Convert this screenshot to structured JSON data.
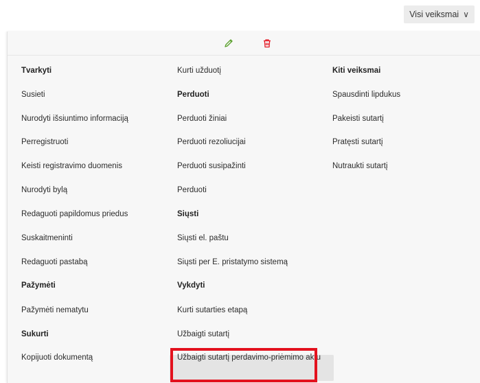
{
  "header": {
    "all_actions_label": "Visi veiksmai",
    "chevron": "∨"
  },
  "toolbar": {
    "edit_icon": "pencil-icon",
    "delete_icon": "trash-icon",
    "edit_color": "#5aa02c",
    "delete_color": "#e3121e"
  },
  "columns": [
    {
      "items": [
        {
          "label": "Tvarkyti",
          "heading": true
        },
        {
          "label": "Susieti",
          "heading": false
        },
        {
          "label": "Nurodyti išsiuntimo informaciją",
          "heading": false
        },
        {
          "label": "Perregistruoti",
          "heading": false
        },
        {
          "label": "Keisti registravimo duomenis",
          "heading": false
        },
        {
          "label": "Nurodyti bylą",
          "heading": false
        },
        {
          "label": "Redaguoti papildomus priedus",
          "heading": false
        },
        {
          "label": "Suskaitmeninti",
          "heading": false
        },
        {
          "label": "Redaguoti pastabą",
          "heading": false
        },
        {
          "label": "Pažymėti",
          "heading": true
        },
        {
          "label": "Pažymėti nematytu",
          "heading": false
        },
        {
          "label": "Sukurti",
          "heading": true
        },
        {
          "label": "Kopijuoti dokumentą",
          "heading": false
        }
      ]
    },
    {
      "items": [
        {
          "label": "Kurti užduotį",
          "heading": false
        },
        {
          "label": "Perduoti",
          "heading": true
        },
        {
          "label": "Perduoti žiniai",
          "heading": false
        },
        {
          "label": "Perduoti rezoliucijai",
          "heading": false
        },
        {
          "label": "Perduoti susipažinti",
          "heading": false
        },
        {
          "label": "Perduoti",
          "heading": false
        },
        {
          "label": "Siųsti",
          "heading": true
        },
        {
          "label": "Siųsti el. paštu",
          "heading": false
        },
        {
          "label": "Siųsti per E. pristatymo sistemą",
          "heading": false
        },
        {
          "label": "Vykdyti",
          "heading": true
        },
        {
          "label": "Kurti sutarties etapą",
          "heading": false
        },
        {
          "label": "Užbaigti sutartį",
          "heading": false
        },
        {
          "label": "Užbaigti sutartį perdavimo-priėmimo aktu",
          "heading": false
        }
      ]
    },
    {
      "items": [
        {
          "label": "Kiti veiksmai",
          "heading": true
        },
        {
          "label": "Spausdinti lipdukus",
          "heading": false
        },
        {
          "label": "Pakeisti sutartį",
          "heading": false
        },
        {
          "label": "Pratęsti sutartį",
          "heading": false
        },
        {
          "label": "Nutraukti sutartį",
          "heading": false
        }
      ]
    }
  ]
}
